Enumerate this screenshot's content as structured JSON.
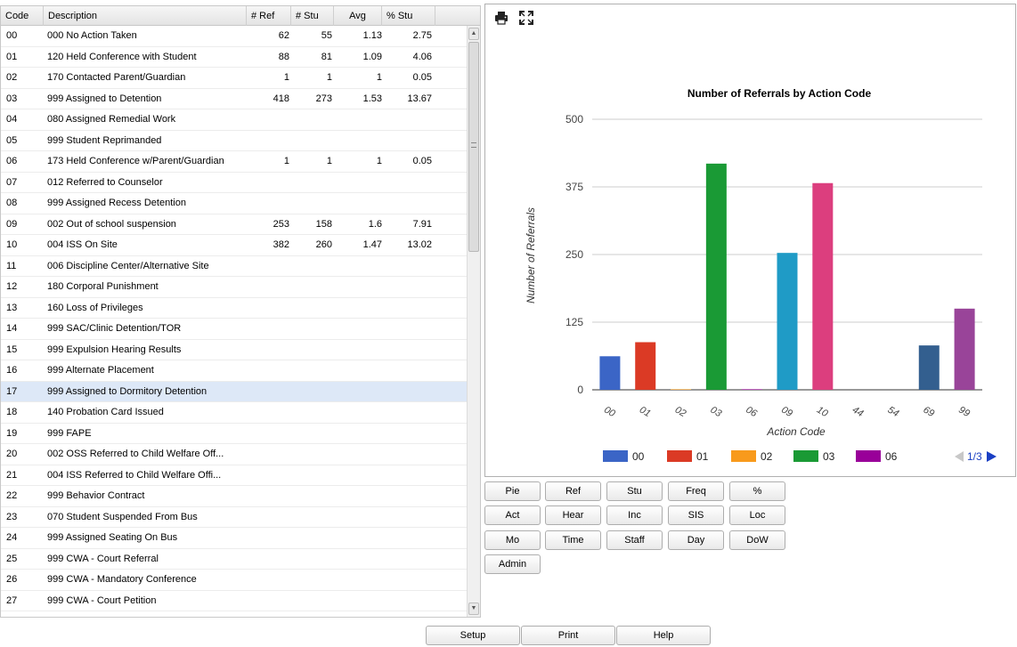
{
  "table": {
    "columns": [
      "Code",
      "Description",
      "# Ref",
      "# Stu",
      "Avg",
      "% Stu"
    ],
    "rows": [
      {
        "code": "00",
        "desc": "000 No Action Taken",
        "ref": "62",
        "stu": "55",
        "avg": "1.13",
        "pct": "2.75"
      },
      {
        "code": "01",
        "desc": "120 Held Conference with Student",
        "ref": "88",
        "stu": "81",
        "avg": "1.09",
        "pct": "4.06"
      },
      {
        "code": "02",
        "desc": "170 Contacted Parent/Guardian",
        "ref": "1",
        "stu": "1",
        "avg": "1",
        "pct": "0.05"
      },
      {
        "code": "03",
        "desc": "999 Assigned to Detention",
        "ref": "418",
        "stu": "273",
        "avg": "1.53",
        "pct": "13.67"
      },
      {
        "code": "04",
        "desc": "080 Assigned Remedial Work",
        "ref": "",
        "stu": "",
        "avg": "",
        "pct": ""
      },
      {
        "code": "05",
        "desc": "999 Student Reprimanded",
        "ref": "",
        "stu": "",
        "avg": "",
        "pct": ""
      },
      {
        "code": "06",
        "desc": "173 Held Conference w/Parent/Guardian",
        "ref": "1",
        "stu": "1",
        "avg": "1",
        "pct": "0.05"
      },
      {
        "code": "07",
        "desc": "012 Referred to Counselor",
        "ref": "",
        "stu": "",
        "avg": "",
        "pct": ""
      },
      {
        "code": "08",
        "desc": "999 Assigned Recess Detention",
        "ref": "",
        "stu": "",
        "avg": "",
        "pct": ""
      },
      {
        "code": "09",
        "desc": "002 Out of school suspension",
        "ref": "253",
        "stu": "158",
        "avg": "1.6",
        "pct": "7.91"
      },
      {
        "code": "10",
        "desc": "004 ISS On Site",
        "ref": "382",
        "stu": "260",
        "avg": "1.47",
        "pct": "13.02"
      },
      {
        "code": "11",
        "desc": "006 Discipline Center/Alternative Site",
        "ref": "",
        "stu": "",
        "avg": "",
        "pct": ""
      },
      {
        "code": "12",
        "desc": "180 Corporal Punishment",
        "ref": "",
        "stu": "",
        "avg": "",
        "pct": ""
      },
      {
        "code": "13",
        "desc": "160 Loss of Privileges",
        "ref": "",
        "stu": "",
        "avg": "",
        "pct": ""
      },
      {
        "code": "14",
        "desc": "999 SAC/Clinic Detention/TOR",
        "ref": "",
        "stu": "",
        "avg": "",
        "pct": ""
      },
      {
        "code": "15",
        "desc": "999 Expulsion Hearing Results",
        "ref": "",
        "stu": "",
        "avg": "",
        "pct": ""
      },
      {
        "code": "16",
        "desc": "999 Alternate Placement",
        "ref": "",
        "stu": "",
        "avg": "",
        "pct": ""
      },
      {
        "code": "17",
        "desc": "999 Assigned to Dormitory Detention",
        "ref": "",
        "stu": "",
        "avg": "",
        "pct": "",
        "selected": true
      },
      {
        "code": "18",
        "desc": "140 Probation Card Issued",
        "ref": "",
        "stu": "",
        "avg": "",
        "pct": ""
      },
      {
        "code": "19",
        "desc": "999 FAPE",
        "ref": "",
        "stu": "",
        "avg": "",
        "pct": ""
      },
      {
        "code": "20",
        "desc": "002 OSS Referred to Child Welfare Off...",
        "ref": "",
        "stu": "",
        "avg": "",
        "pct": ""
      },
      {
        "code": "21",
        "desc": "004 ISS Referred to Child Welfare Offi...",
        "ref": "",
        "stu": "",
        "avg": "",
        "pct": ""
      },
      {
        "code": "22",
        "desc": "999 Behavior Contract",
        "ref": "",
        "stu": "",
        "avg": "",
        "pct": ""
      },
      {
        "code": "23",
        "desc": "070 Student Suspended From Bus",
        "ref": "",
        "stu": "",
        "avg": "",
        "pct": ""
      },
      {
        "code": "24",
        "desc": "999 Assigned Seating On Bus",
        "ref": "",
        "stu": "",
        "avg": "",
        "pct": ""
      },
      {
        "code": "25",
        "desc": "999 CWA - Court Referral",
        "ref": "",
        "stu": "",
        "avg": "",
        "pct": ""
      },
      {
        "code": "26",
        "desc": "999 CWA - Mandatory Conference",
        "ref": "",
        "stu": "",
        "avg": "",
        "pct": ""
      },
      {
        "code": "27",
        "desc": "999 CWA - Court Petition",
        "ref": "",
        "stu": "",
        "avg": "",
        "pct": ""
      }
    ]
  },
  "chart_toolbar": {
    "print_icon": "printer-icon",
    "expand_icon": "fullscreen-icon"
  },
  "chart_data": {
    "type": "bar",
    "title": "Number of Referrals by Action Code",
    "xlabel": "Action Code",
    "ylabel": "Number of Referrals",
    "categories": [
      "00",
      "01",
      "02",
      "03",
      "06",
      "09",
      "10",
      "44",
      "54",
      "69",
      "99"
    ],
    "values": [
      62,
      88,
      1,
      418,
      1,
      253,
      382,
      0,
      0,
      82,
      150
    ],
    "colors": [
      "#3b65c6",
      "#db3a25",
      "#f89a1c",
      "#1a9a35",
      "#990099",
      "#1f9bc6",
      "#dc3e7e",
      "#5c9c1f",
      "#b32e2e",
      "#335f8f",
      "#994499"
    ],
    "ylim": [
      0,
      500
    ],
    "yticks": [
      0,
      125,
      250,
      375,
      500
    ],
    "grid": true,
    "legend": {
      "position": "bottom",
      "items": [
        {
          "label": "00",
          "color": "#3b65c6"
        },
        {
          "label": "01",
          "color": "#db3a25"
        },
        {
          "label": "02",
          "color": "#f89a1c"
        },
        {
          "label": "03",
          "color": "#1a9a35"
        },
        {
          "label": "06",
          "color": "#990099"
        }
      ],
      "page": "1/3"
    }
  },
  "chart_buttons": [
    [
      "Pie",
      "Ref",
      "Stu",
      "Freq",
      "%"
    ],
    [
      "Act",
      "Hear",
      "Inc",
      "SIS",
      "Loc"
    ],
    [
      "Mo",
      "Time",
      "Staff",
      "Day",
      "DoW"
    ],
    [
      "Admin"
    ]
  ],
  "footer_buttons": [
    "Setup",
    "Print",
    "Help"
  ]
}
